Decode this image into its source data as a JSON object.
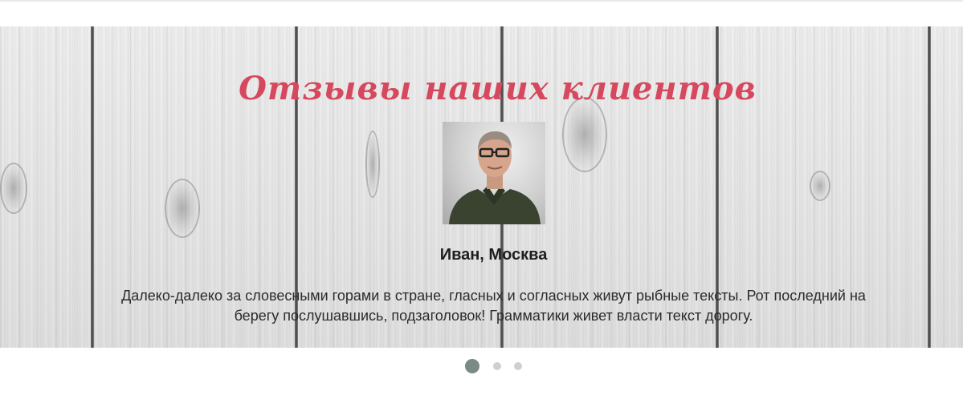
{
  "section": {
    "title": "Отзывы наших клиентов"
  },
  "testimonial": {
    "author": "Иван, Москва",
    "text": "Далеко-далеко за словесными горами в стране, гласных и согласных живут рыбные тексты. Рот последний на берегу послушавшись, подзаголовок! Грамматики живет власти текст дорогу.",
    "photo": "man-with-glasses-portrait"
  },
  "carousel": {
    "slides_total": 3,
    "active_index": 1
  },
  "colors": {
    "title": "#d6485d",
    "dot_active": "#7b8a87",
    "dot_inactive": "#cfcfcf"
  }
}
